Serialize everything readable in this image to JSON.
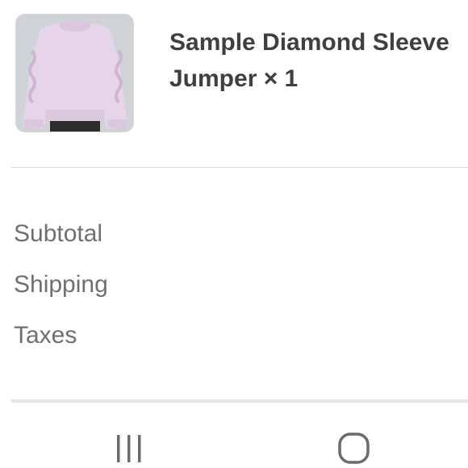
{
  "product": {
    "name_line1": "Sample Diamond Sleeve",
    "name_line2": "Jumper × 1",
    "thumbnail_icon": "sweater-photo"
  },
  "summary": {
    "subtotal_label": "Subtotal",
    "shipping_label": "Shipping",
    "taxes_label": "Taxes"
  },
  "system_nav": {
    "recents_icon": "recents-icon",
    "home_icon": "home-icon"
  },
  "colors": {
    "text_dark": "#3f3f3f",
    "text_muted": "#6f6f6f",
    "divider": "#dcdcdc",
    "sweater": "#e6d3e6"
  }
}
